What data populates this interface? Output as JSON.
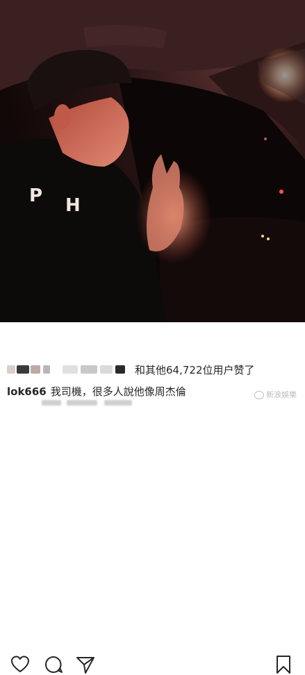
{
  "post": {
    "photo_alt": "",
    "actions": {
      "like_icon": "heart-icon",
      "comment_icon": "comment-icon",
      "share_icon": "send-icon",
      "save_icon": "bookmark-icon"
    },
    "likes_text": "和其他64,722位用户赞了",
    "caption": {
      "username": "lok666",
      "text": "我司機，很多人說他像周杰倫"
    }
  },
  "watermark": {
    "text": "新浪娛樂"
  }
}
